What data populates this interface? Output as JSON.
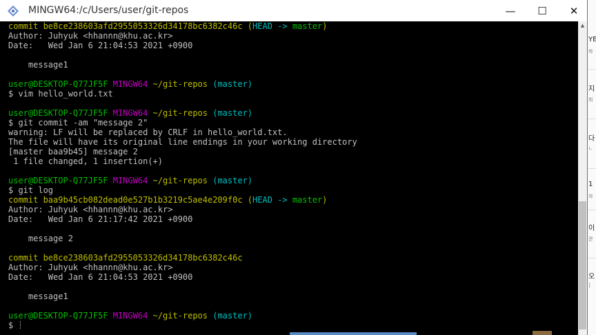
{
  "window": {
    "title": "MINGW64:/c/Users/user/git-repos",
    "minimize_glyph": "—",
    "maximize_glyph": "☐",
    "close_glyph": "✕",
    "icon": "mingw-app-icon"
  },
  "colors": {
    "background": "#000000",
    "text": "#c0c0c0",
    "yellow": "#bfbf00",
    "cyan": "#00bfbf",
    "green": "#00bf00",
    "magenta": "#bf00bf"
  },
  "terminal": {
    "lines": [
      [
        {
          "t": "commit be8ce238603afd2955053326d34178bc6382c46c ",
          "c": "yellow"
        },
        {
          "t": "(",
          "c": "yellow"
        },
        {
          "t": "HEAD -> ",
          "c": "cyan"
        },
        {
          "t": "master",
          "c": "green"
        },
        {
          "t": ")",
          "c": "yellow"
        }
      ],
      [
        {
          "t": "Author: Juhyuk <hhannn@khu.ac.kr>",
          "c": "plain"
        }
      ],
      [
        {
          "t": "Date:   Wed Jan 6 21:04:53 2021 +0900",
          "c": "plain"
        }
      ],
      [],
      [
        {
          "t": "    message1",
          "c": "plain"
        }
      ],
      [],
      [
        {
          "t": "user@DESKTOP-Q77JF5F ",
          "c": "green"
        },
        {
          "t": "MINGW64 ",
          "c": "magenta"
        },
        {
          "t": "~/git-repos ",
          "c": "yellow"
        },
        {
          "t": "(master)",
          "c": "cyan"
        }
      ],
      [
        {
          "t": "$ vim hello_world.txt",
          "c": "plain"
        }
      ],
      [],
      [
        {
          "t": "user@DESKTOP-Q77JF5F ",
          "c": "green"
        },
        {
          "t": "MINGW64 ",
          "c": "magenta"
        },
        {
          "t": "~/git-repos ",
          "c": "yellow"
        },
        {
          "t": "(master)",
          "c": "cyan"
        }
      ],
      [
        {
          "t": "$ git commit -am \"message 2\"",
          "c": "plain"
        }
      ],
      [
        {
          "t": "warning: LF will be replaced by CRLF in hello_world.txt.",
          "c": "plain"
        }
      ],
      [
        {
          "t": "The file will have its original line endings in your working directory",
          "c": "plain"
        }
      ],
      [
        {
          "t": "[master baa9b45] message 2",
          "c": "plain"
        }
      ],
      [
        {
          "t": " 1 file changed, 1 insertion(+)",
          "c": "plain"
        }
      ],
      [],
      [
        {
          "t": "user@DESKTOP-Q77JF5F ",
          "c": "green"
        },
        {
          "t": "MINGW64 ",
          "c": "magenta"
        },
        {
          "t": "~/git-repos ",
          "c": "yellow"
        },
        {
          "t": "(master)",
          "c": "cyan"
        }
      ],
      [
        {
          "t": "$ git log",
          "c": "plain"
        }
      ],
      [
        {
          "t": "commit baa9b45cb082dead0e527b1b3219c5ae4e209f0c ",
          "c": "yellow"
        },
        {
          "t": "(",
          "c": "yellow"
        },
        {
          "t": "HEAD -> ",
          "c": "cyan"
        },
        {
          "t": "master",
          "c": "green"
        },
        {
          "t": ")",
          "c": "yellow"
        }
      ],
      [
        {
          "t": "Author: Juhyuk <hhannn@khu.ac.kr>",
          "c": "plain"
        }
      ],
      [
        {
          "t": "Date:   Wed Jan 6 21:17:42 2021 +0900",
          "c": "plain"
        }
      ],
      [],
      [
        {
          "t": "    message 2",
          "c": "plain"
        }
      ],
      [],
      [
        {
          "t": "commit be8ce238603afd2955053326d34178bc6382c46c",
          "c": "yellow"
        }
      ],
      [
        {
          "t": "Author: Juhyuk <hhannn@khu.ac.kr>",
          "c": "plain"
        }
      ],
      [
        {
          "t": "Date:   Wed Jan 6 21:04:53 2021 +0900",
          "c": "plain"
        }
      ],
      [],
      [
        {
          "t": "    message1",
          "c": "plain"
        }
      ],
      [],
      [
        {
          "t": "user@DESKTOP-Q77JF5F ",
          "c": "green"
        },
        {
          "t": "MINGW64 ",
          "c": "magenta"
        },
        {
          "t": "~/git-repos ",
          "c": "yellow"
        },
        {
          "t": "(master)",
          "c": "cyan"
        }
      ],
      [
        {
          "t": "$ ",
          "c": "plain"
        }
      ]
    ],
    "cursor_line": 31
  },
  "background_app": {
    "fragments": [
      {
        "text": "YE",
        "size": "normal"
      },
      {
        "text": "하",
        "size": "small"
      },
      {
        "text": "지",
        "size": "normal"
      },
      {
        "text": "최",
        "size": "small"
      },
      {
        "text": "다",
        "size": "normal"
      },
      {
        "text": "ㄴ",
        "size": "small"
      },
      {
        "text": "1",
        "size": "normal"
      },
      {
        "text": "자",
        "size": "small"
      },
      {
        "text": "이",
        "size": "normal"
      },
      {
        "text": "관",
        "size": "small"
      },
      {
        "text": "오",
        "size": "normal"
      },
      {
        "text": "]",
        "size": "small"
      }
    ]
  }
}
